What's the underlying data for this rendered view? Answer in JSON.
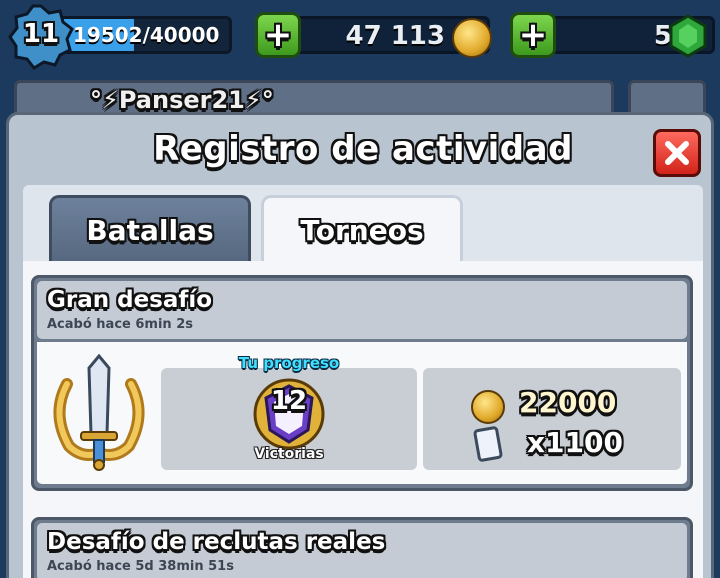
{
  "hud": {
    "level": "11",
    "xp": "19502/40000",
    "xp_progress": 0.4876,
    "gold": "47 113",
    "gems": "5",
    "player_name": "°⚡Panser21⚡°"
  },
  "modal": {
    "title": "Registro de actividad",
    "tabs": [
      {
        "label": "Batallas",
        "selected": false
      },
      {
        "label": "Torneos",
        "selected": true
      }
    ]
  },
  "entries": [
    {
      "title": "Gran desafío",
      "time": "Acabó hace 6min  2s",
      "progress_label": "Tu progreso",
      "wins": "12",
      "wins_label": "Victorias",
      "reward_gold": "22000",
      "reward_cards": "x1100"
    },
    {
      "title": "Desafío de reclutas reales",
      "time": "Acabó hace 5d 38min  51s"
    }
  ],
  "colors": {
    "background": "#1b3a5e",
    "progress_label": "#3fe0ff",
    "win_shield": "#6a3fc8",
    "close_button": "#d1231a",
    "plus_button": "#3e9a1e"
  }
}
